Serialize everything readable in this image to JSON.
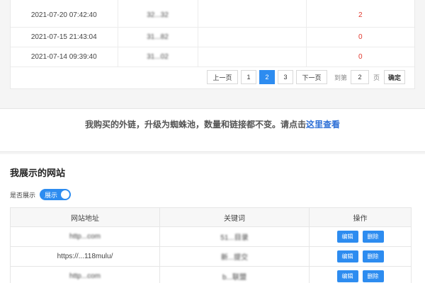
{
  "orders": {
    "rows": [
      {
        "date": "2021-07-20 07:42:40",
        "mid": "32...32",
        "extra": "",
        "count": "2"
      },
      {
        "date": "2021-07-15 21:43:04",
        "mid": "31...82",
        "extra": "",
        "count": "0"
      },
      {
        "date": "2021-07-14 09:39:40",
        "mid": "31...02",
        "extra": "",
        "count": "0"
      }
    ]
  },
  "pagination": {
    "prev": "上一页",
    "pages": [
      "1",
      "2",
      "3"
    ],
    "active_page": "2",
    "next": "下一页",
    "goto_label": "到第",
    "goto_value": "2",
    "unit": "页",
    "confirm": "确定"
  },
  "notice": {
    "text": "我购买的外链，升级为蜘蛛池，数量和链接都不变。请点击",
    "link": "这里查看"
  },
  "sites": {
    "title": "我展示的网站",
    "toggle_label": "是否展示",
    "toggle_text": "展示",
    "toggle_on": true,
    "columns": [
      "网站地址",
      "关键词",
      "操作"
    ],
    "edit_label": "编辑",
    "delete_label": "删除",
    "rows": [
      {
        "url": "http...com",
        "keyword": "51...目录"
      },
      {
        "url": "https://...118mulu/",
        "keyword": "新...提交"
      },
      {
        "url": "http...com",
        "keyword": "b...联盟"
      }
    ]
  },
  "colors": {
    "accent": "#2d8cf0",
    "red": "#e0392e",
    "link": "#2d6fd6"
  }
}
